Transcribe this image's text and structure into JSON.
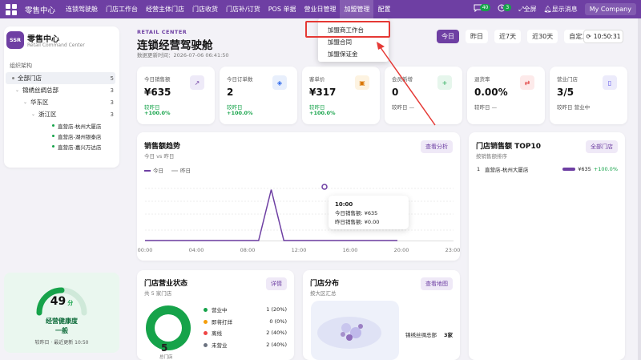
{
  "topbar": {
    "brand": "零售中心",
    "nav": [
      "连锁驾驶舱",
      "门店工作台",
      "经营主体门店",
      "门店收货",
      "门店补/订货",
      "POS 单据",
      "营业日管理",
      "加盟管理",
      "配置"
    ],
    "messages_count": "40",
    "activity_count": "3",
    "fullscreen": "全屏",
    "show_messages": "显示消息",
    "company": "My Company"
  },
  "dropdown": {
    "items": [
      "加盟商工作台",
      "加盟合同",
      "加盟保证金"
    ]
  },
  "sidebar": {
    "logo": "SSR",
    "title": "零售中心",
    "subtitle": "Retail Command Center",
    "section": "组织架构",
    "tree": [
      {
        "label": "全部门店",
        "count": "5"
      },
      {
        "label": "锦绣丝绸总部",
        "count": "3"
      },
      {
        "label": "华东区",
        "count": "3"
      },
      {
        "label": "浙江区",
        "count": "3"
      },
      {
        "label": "直营店-杭州大厦店"
      },
      {
        "label": "直营店-湖州银泰店"
      },
      {
        "label": "直营店-嘉兴万达店"
      }
    ]
  },
  "health": {
    "score": "49",
    "unit": "分",
    "label": "经营健康度",
    "level": "一般",
    "updated": "较昨日 · 最近更新 10:50"
  },
  "header": {
    "kicker": "RETAIL CENTER",
    "title": "连锁经营驾驶舱",
    "updated": "数据更新时间：2026-07-06 06:41:50",
    "periods": [
      "今日",
      "昨日",
      "近7天",
      "近30天",
      "自定义"
    ],
    "time": "10:50:31"
  },
  "kpis": [
    {
      "label": "今日销售额",
      "value": "¥635",
      "sub": "较昨日",
      "rate": "+100.0%",
      "icon": "trend-icon",
      "color": "#6e3fa3",
      "bg": "#eeeaf8"
    },
    {
      "label": "今日订单数",
      "value": "2",
      "sub": "较昨日",
      "rate": "+100.0%",
      "icon": "tag-icon",
      "color": "#2563eb",
      "bg": "#e8effc"
    },
    {
      "label": "客单价",
      "value": "¥317",
      "sub": "较昨日",
      "rate": "+100.0%",
      "icon": "wallet-icon",
      "color": "#d97706",
      "bg": "#fdf3e1"
    },
    {
      "label": "会员新增",
      "value": "0",
      "sub": "较昨日 —",
      "rate": "",
      "icon": "user-add-icon",
      "color": "#16a34a",
      "bg": "#e6f6ec"
    },
    {
      "label": "退货率",
      "value": "0.00%",
      "sub": "较昨日 —",
      "rate": "",
      "icon": "return-icon",
      "color": "#dc2626",
      "bg": "#fdeaea"
    },
    {
      "label": "营业门店",
      "value": "3/5",
      "sub": "较昨日 营业中",
      "rate": "",
      "icon": "phone-icon",
      "color": "#4f46e5",
      "bg": "#ecebfb"
    }
  ],
  "trend": {
    "title": "销售额趋势",
    "subtitle": "今日 vs 昨日",
    "button": "查看分析",
    "legend_today": "今日",
    "legend_yesterday": "昨日",
    "tooltip": {
      "time": "10:00",
      "today": "今日销售额: ¥635",
      "yesterday": "昨日销售额: ¥0.00"
    }
  },
  "chart_data": {
    "type": "line",
    "x": [
      "00:00",
      "04:00",
      "08:00",
      "12:00",
      "16:00",
      "20:00",
      "23:00"
    ],
    "series": [
      {
        "name": "今日",
        "points": [
          [
            0,
            0
          ],
          [
            1,
            0
          ],
          [
            2,
            0
          ],
          [
            3,
            0
          ],
          [
            4,
            0
          ],
          [
            5,
            0
          ],
          [
            6,
            0
          ],
          [
            7,
            0
          ],
          [
            8,
            0
          ],
          [
            9,
            0
          ],
          [
            10,
            635
          ],
          [
            11,
            0
          ],
          [
            12,
            0
          ],
          [
            13,
            0
          ],
          [
            14,
            0
          ],
          [
            15,
            0
          ],
          [
            16,
            0
          ],
          [
            17,
            0
          ],
          [
            18,
            0
          ],
          [
            19,
            0
          ],
          [
            20,
            0
          ]
        ]
      },
      {
        "name": "昨日",
        "points": [
          [
            0,
            0
          ],
          [
            23,
            0
          ]
        ]
      }
    ],
    "ylim": [
      0,
      700
    ]
  },
  "top10": {
    "title": "门店销售额 TOP10",
    "subtitle": "按销售额排序",
    "button": "全部门店",
    "rows": [
      {
        "rank": "1",
        "name": "直营店-杭州大厦店",
        "value": "¥635",
        "rate": "+100.0%"
      }
    ]
  },
  "status": {
    "title": "门店营业状态",
    "subtitle": "共 5 家门店",
    "button": "详情",
    "center_value": "5",
    "center_label": "总门店",
    "rows": [
      {
        "label": "营业中",
        "value": "1 (20%)",
        "color": "#16a34a"
      },
      {
        "label": "即将打烊",
        "value": "0 (0%)",
        "color": "#f59e0b"
      },
      {
        "label": "离线",
        "value": "2 (40%)",
        "color": "#ef4444"
      },
      {
        "label": "未营业",
        "value": "2 (40%)",
        "color": "#6b7280"
      }
    ]
  },
  "distribution": {
    "title": "门店分布",
    "subtitle": "按大区汇总",
    "button": "查看地图",
    "region": "锦绣丝绸总部",
    "region_count": "3家"
  }
}
